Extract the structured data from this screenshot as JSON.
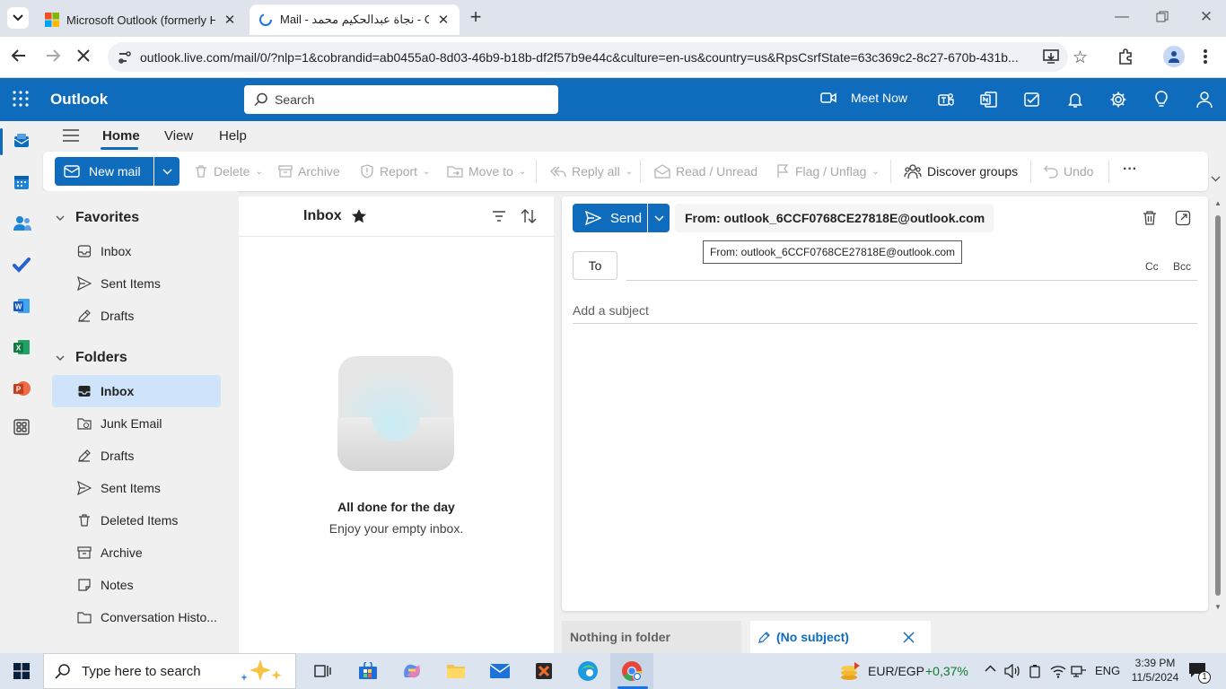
{
  "browser": {
    "tabs": [
      {
        "title": "Microsoft Outlook (formerly Ho",
        "active": false
      },
      {
        "title": "Mail - نجاة عبدالحكيم محمد - Out",
        "active": true
      }
    ],
    "new_tab": "+",
    "url": "outlook.live.com/mail/0/?nlp=1&cobrandid=ab0455a0-8d03-46b9-b18b-df2f57b9e44c&culture=en-us&country=us&RpsCsrfState=63c369c2-8c27-670b-431b..."
  },
  "header": {
    "app_name": "Outlook",
    "search_placeholder": "Search",
    "meet_now": "Meet Now",
    "brand_color": "#0f6cbd"
  },
  "ribbon": {
    "tabs": [
      "Home",
      "View",
      "Help"
    ],
    "new_mail": "New mail",
    "delete": "Delete",
    "archive": "Archive",
    "report": "Report",
    "move_to": "Move to",
    "reply_all": "Reply all",
    "read_unread": "Read / Unread",
    "flag_unflag": "Flag / Unflag",
    "discover_groups": "Discover groups",
    "undo": "Undo",
    "more": "···"
  },
  "folders": {
    "favorites_title": "Favorites",
    "favorites": [
      "Inbox",
      "Sent Items",
      "Drafts"
    ],
    "folders_title": "Folders",
    "items": [
      "Inbox",
      "Junk Email",
      "Drafts",
      "Sent Items",
      "Deleted Items",
      "Archive",
      "Notes",
      "Conversation Histo..."
    ]
  },
  "message_list": {
    "title": "Inbox",
    "empty_title": "All done for the day",
    "empty_sub": "Enjoy your empty inbox."
  },
  "compose": {
    "send": "Send",
    "from": "From: outlook_6CCF0768CE27818E@outlook.com",
    "tooltip": "From: outlook_6CCF0768CE27818E@outlook.com",
    "to": "To",
    "cc": "Cc",
    "bcc": "Bcc",
    "subject_placeholder": "Add a subject"
  },
  "bottom_tabs": {
    "nothing": "Nothing in folder",
    "draft": "(No subject)"
  },
  "taskbar": {
    "search_placeholder": "Type here to search",
    "currency": "EUR/EGP",
    "currency_change": "+0,37%",
    "lang": "ENG",
    "time": "3:39 PM",
    "date": "11/5/2024",
    "notifications": "1"
  }
}
